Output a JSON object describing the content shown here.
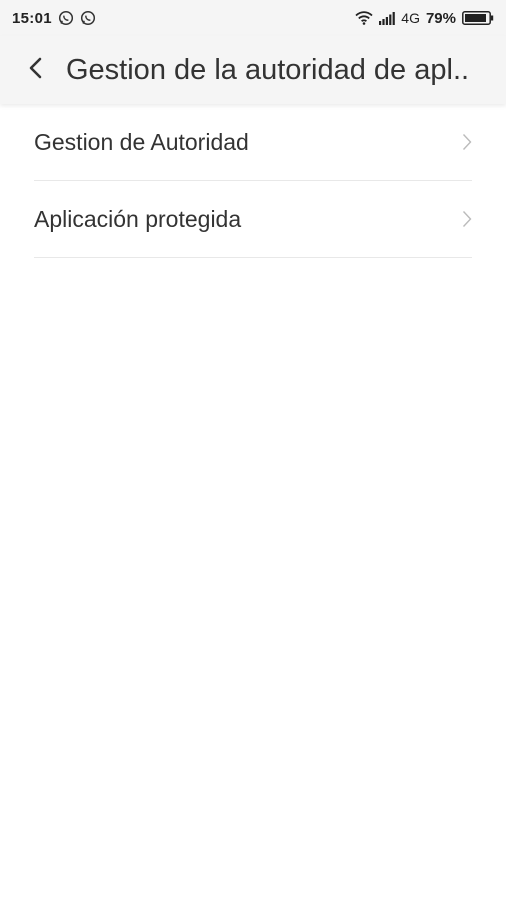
{
  "status_bar": {
    "time": "15:01",
    "network_type": "4G",
    "battery_percent": "79%"
  },
  "header": {
    "title": "Gestion de la autoridad de apl.."
  },
  "menu": {
    "items": [
      {
        "label": "Gestion de Autoridad"
      },
      {
        "label": "Aplicación protegida"
      }
    ]
  },
  "icons": {
    "back": "chevron-left-icon",
    "row": "chevron-right-icon",
    "notifications": [
      "whatsapp-icon",
      "whatsapp-icon"
    ],
    "status": [
      "wifi-icon",
      "signal-icon",
      "battery-icon"
    ]
  },
  "colors": {
    "bar_background": "#f5f5f5",
    "text": "#333333",
    "divider": "#e8e8e8",
    "chevron": "#bbbbbb"
  }
}
